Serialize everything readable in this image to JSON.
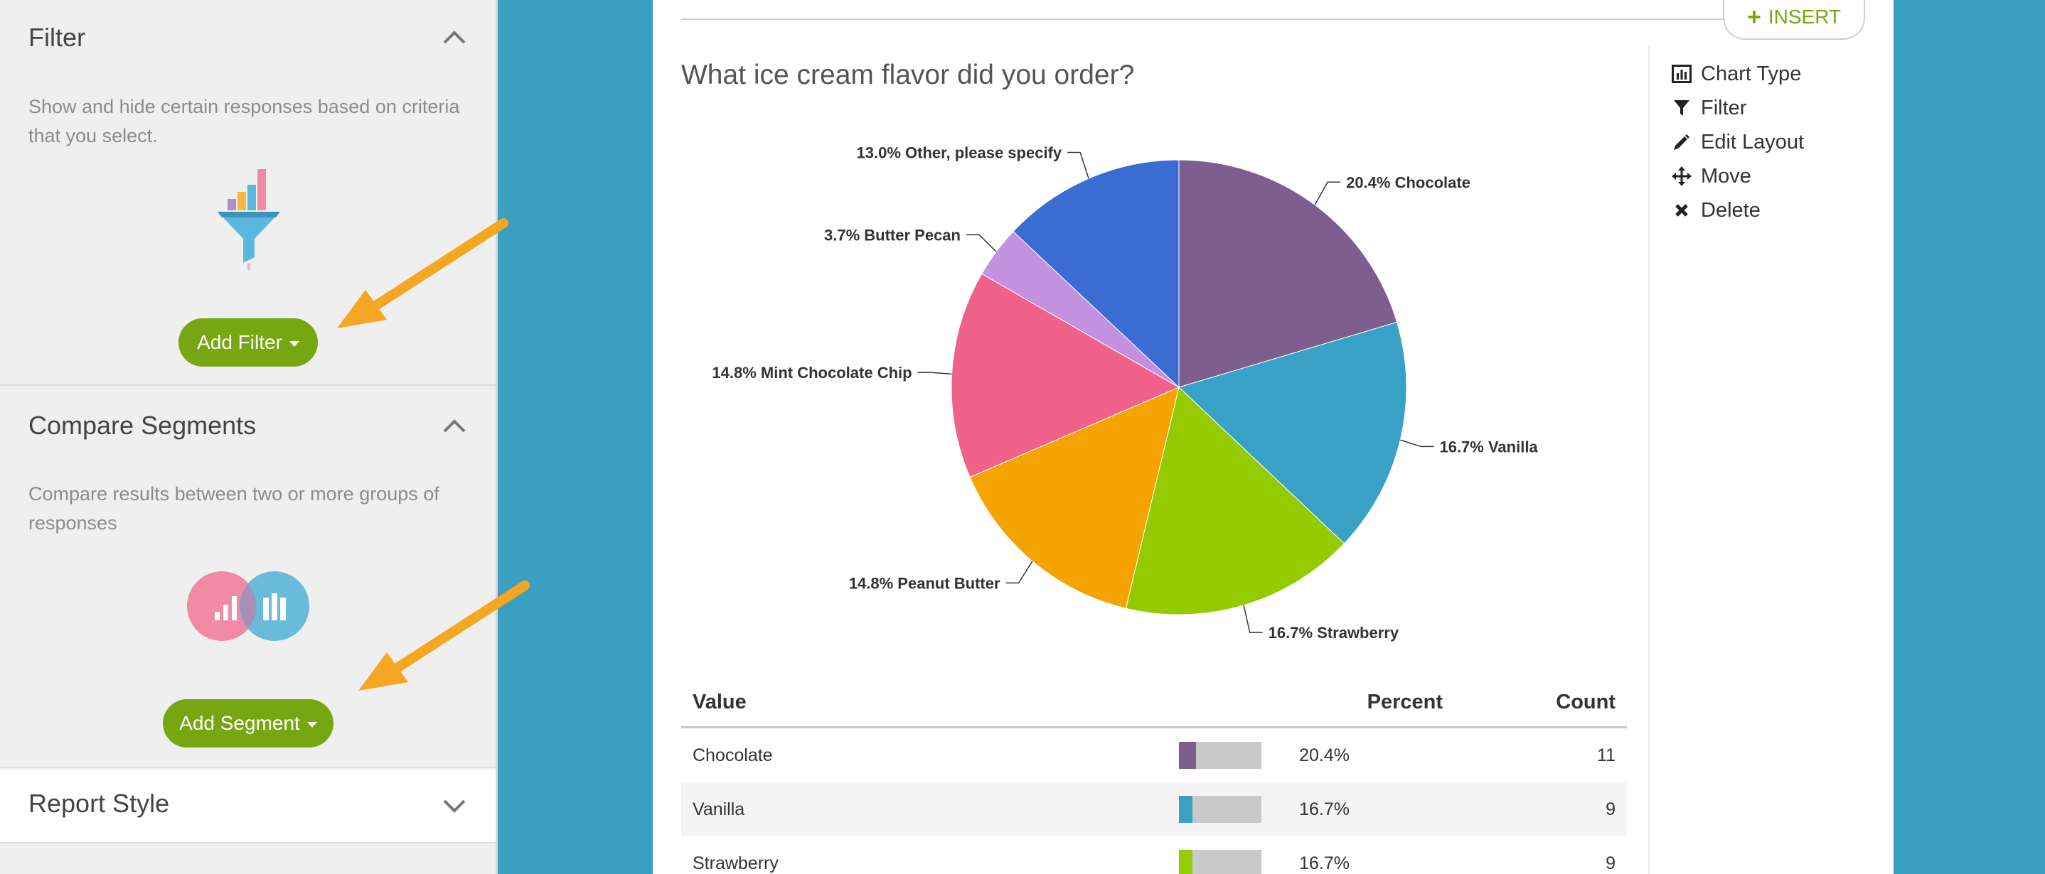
{
  "sidebar": {
    "filter": {
      "title": "Filter",
      "description": "Show and hide certain responses based on criteria that you select.",
      "button_label": "Add Filter"
    },
    "compare": {
      "title": "Compare Segments",
      "description": "Compare results between two or more groups of responses",
      "button_label": "Add Segment"
    },
    "style": {
      "title": "Report Style"
    }
  },
  "toolbar": {
    "insert_label": "INSERT"
  },
  "question": {
    "title": "What ice cream flavor did you order?"
  },
  "actions": [
    {
      "label": "Chart Type",
      "icon": "bar-chart-icon"
    },
    {
      "label": "Filter",
      "icon": "filter-icon"
    },
    {
      "label": "Edit Layout",
      "icon": "pencil-icon"
    },
    {
      "label": "Move",
      "icon": "move-icon"
    },
    {
      "label": "Delete",
      "icon": "x-icon"
    }
  ],
  "chart_data": {
    "type": "pie",
    "title": "What ice cream flavor did you order?",
    "categories": [
      "Chocolate",
      "Vanilla",
      "Strawberry",
      "Peanut Butter",
      "Mint Chocolate Chip",
      "Butter Pecan",
      "Other, please specify"
    ],
    "values": [
      20.4,
      16.7,
      16.7,
      14.8,
      14.8,
      3.7,
      13.0
    ],
    "labels": [
      "20.4% Chocolate",
      "16.7% Vanilla",
      "16.7% Strawberry",
      "14.8% Peanut Butter",
      "14.8% Mint Chocolate Chip",
      "3.7% Butter Pecan",
      "13.0% Other, please specify"
    ],
    "colors": [
      "#7d5e8f",
      "#3aa1c6",
      "#93cb00",
      "#f5a300",
      "#f0628a",
      "#c391e0",
      "#3a6cd1"
    ]
  },
  "table": {
    "headers": {
      "value": "Value",
      "percent": "Percent",
      "count": "Count"
    },
    "rows": [
      {
        "value": "Chocolate",
        "percent": "20.4%",
        "count": "11",
        "fraction": 0.204,
        "color": "#7d5e8f"
      },
      {
        "value": "Vanilla",
        "percent": "16.7%",
        "count": "9",
        "fraction": 0.167,
        "color": "#3aa1c6"
      },
      {
        "value": "Strawberry",
        "percent": "16.7%",
        "count": "9",
        "fraction": 0.167,
        "color": "#93cb00"
      }
    ]
  },
  "colors": {
    "accent_green": "#77a613",
    "page_blue": "#3a9fc0",
    "arrow_orange": "#f5a623"
  }
}
